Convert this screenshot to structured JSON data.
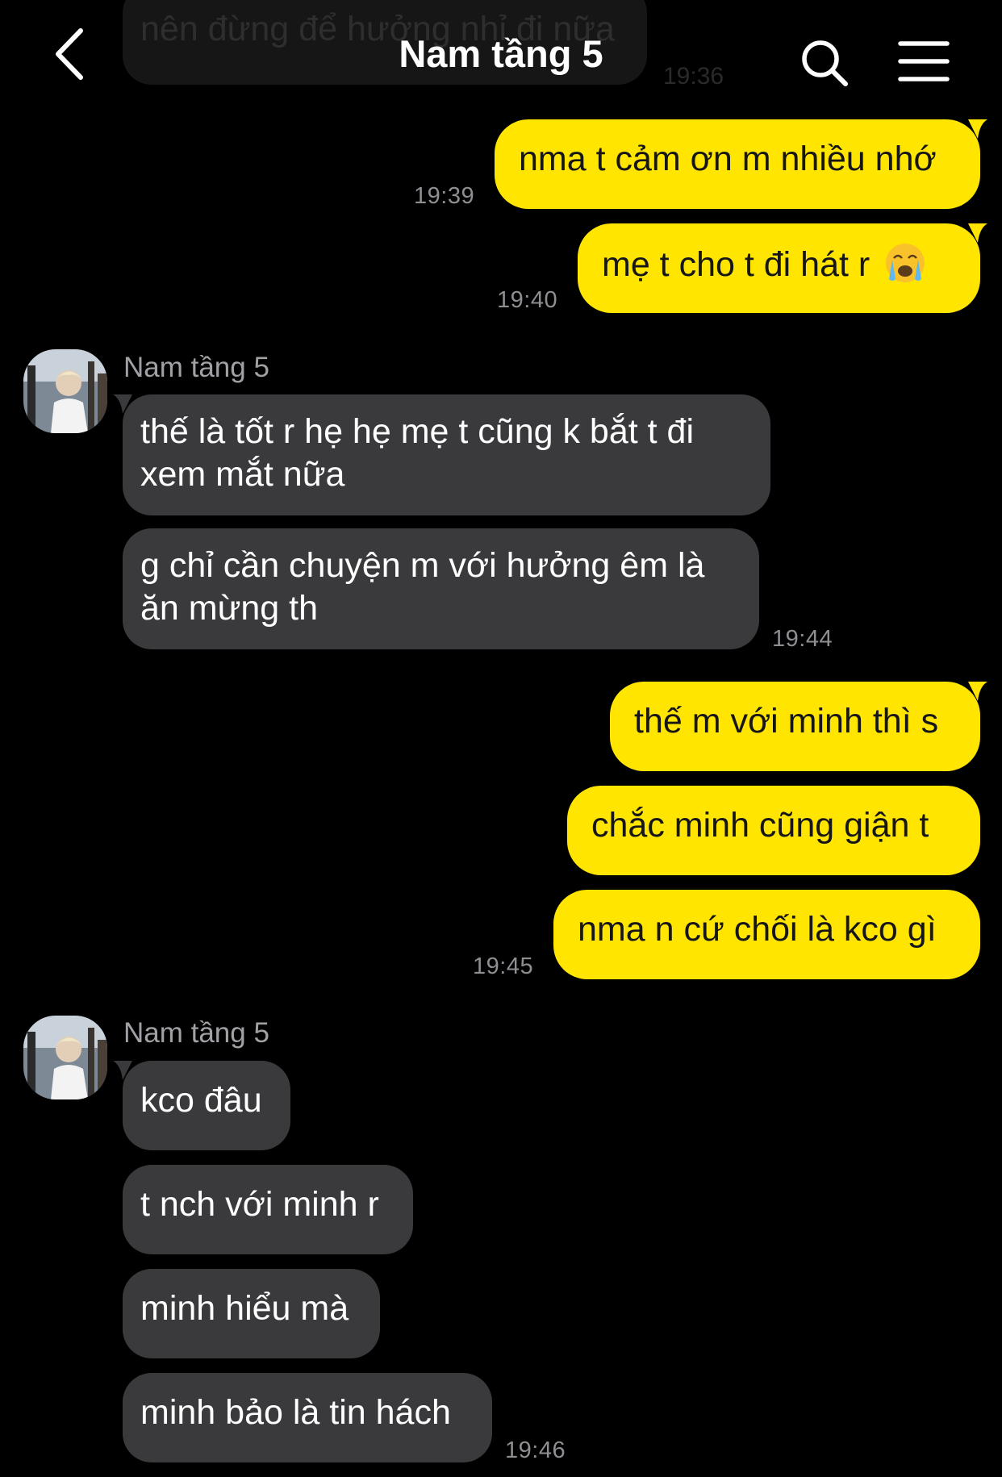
{
  "colors": {
    "background": "#000000",
    "outgoing_bubble": "#ffe500",
    "incoming_bubble": "#3a3a3c",
    "timestamp": "#8e8e93"
  },
  "header": {
    "title": "Nam tầng 5",
    "back_icon": "chevron-left-icon",
    "search_icon": "search-icon",
    "menu_icon": "menu-icon"
  },
  "previous": {
    "text": "nên đừng để hưởng nhỉ đi nữa",
    "time": "19:36"
  },
  "messages": {
    "out1": {
      "text": "nma t cảm ơn m nhiều nhớ",
      "time": "19:39"
    },
    "out2": {
      "text": "mẹ t cho t đi hát r",
      "emoji": "😭",
      "time": "19:40"
    },
    "group1": {
      "sender": "Nam tầng 5",
      "in1_line1": "thế là tốt r hẹ hẹ mẹ t cũng k bắt t đi",
      "in1_line2": "xem mắt nữa",
      "in2_line1": "g chỉ cần chuyện m với hưởng êm là",
      "in2_line2": "ăn mừng th",
      "time": "19:44"
    },
    "out3": {
      "text": "thế m với minh thì s"
    },
    "out4": {
      "text": "chắc minh cũng giận t"
    },
    "out5": {
      "text": "nma n cứ chối là kco gì",
      "time": "19:45"
    },
    "group2": {
      "sender": "Nam tầng 5",
      "in3": "kco đâu",
      "in4": "t nch với minh r",
      "in5": "minh hiểu mà",
      "in6": "minh bảo là tin hách",
      "time": "19:46"
    }
  }
}
